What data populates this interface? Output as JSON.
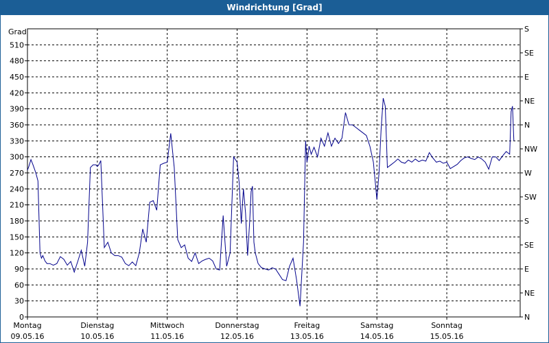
{
  "window": {
    "title": "Windrichtung [Grad]"
  },
  "chart_data": {
    "type": "line",
    "title": "Windrichtung [Grad]",
    "ylabel": "Grad",
    "ylim": [
      0,
      540
    ],
    "ylim_note": "",
    "yticks": [
      0,
      30,
      60,
      90,
      120,
      150,
      180,
      210,
      240,
      270,
      300,
      330,
      360,
      390,
      420,
      450,
      480,
      510
    ],
    "right_ticks": [
      "N",
      "NE",
      "E",
      "SE",
      "S",
      "SW",
      "W",
      "NW",
      "N",
      "NE",
      "E",
      "SE",
      "S"
    ],
    "xlim": [
      0,
      7.05
    ],
    "days": [
      {
        "name": "Montag",
        "date": "09.05.16"
      },
      {
        "name": "Dienstag",
        "date": "10.05.16"
      },
      {
        "name": "Mittwoch",
        "date": "11.05.16"
      },
      {
        "name": "Donnerstag",
        "date": "12.05.16"
      },
      {
        "name": "Freitag",
        "date": "13.05.16"
      },
      {
        "name": "Samstag",
        "date": "14.05.16"
      },
      {
        "name": "Sonntag",
        "date": "15.05.16"
      }
    ],
    "line_color": "#00008b",
    "grid": true,
    "x": [
      0,
      0.02,
      0.05,
      0.08,
      0.12,
      0.15,
      0.18,
      0.2,
      0.22,
      0.25,
      0.28,
      0.32,
      0.37,
      0.42,
      0.47,
      0.52,
      0.57,
      0.62,
      0.67,
      0.72,
      0.77,
      0.82,
      0.86,
      0.9,
      0.94,
      0.98,
      1.0,
      1.02,
      1.05,
      1.1,
      1.15,
      1.2,
      1.25,
      1.3,
      1.35,
      1.4,
      1.45,
      1.5,
      1.55,
      1.6,
      1.65,
      1.7,
      1.75,
      1.8,
      1.85,
      1.9,
      1.95,
      2.0,
      2.05,
      2.1,
      2.15,
      2.2,
      2.25,
      2.3,
      2.35,
      2.4,
      2.45,
      2.5,
      2.55,
      2.6,
      2.65,
      2.7,
      2.75,
      2.8,
      2.85,
      2.9,
      2.95,
      3.0,
      3.03,
      3.06,
      3.09,
      3.12,
      3.15,
      3.18,
      3.2,
      3.22,
      3.24,
      3.26,
      3.3,
      3.35,
      3.4,
      3.45,
      3.5,
      3.55,
      3.6,
      3.65,
      3.7,
      3.75,
      3.8,
      3.85,
      3.9,
      3.95,
      3.98,
      4.0,
      4.03,
      4.06,
      4.1,
      4.15,
      4.2,
      4.25,
      4.3,
      4.35,
      4.4,
      4.45,
      4.5,
      4.55,
      4.6,
      4.65,
      4.7,
      4.75,
      4.8,
      4.85,
      4.9,
      4.95,
      5.0,
      5.03,
      5.06,
      5.09,
      5.12,
      5.15,
      5.2,
      5.25,
      5.3,
      5.35,
      5.4,
      5.45,
      5.5,
      5.55,
      5.6,
      5.65,
      5.7,
      5.75,
      5.8,
      5.85,
      5.9,
      5.95,
      6.0,
      6.05,
      6.1,
      6.15,
      6.2,
      6.25,
      6.3,
      6.35,
      6.4,
      6.45,
      6.5,
      6.55,
      6.6,
      6.65,
      6.7,
      6.75,
      6.8,
      6.85,
      6.9,
      6.92,
      6.94,
      6.96,
      6.98,
      7.0
    ],
    "y": [
      275,
      282,
      295,
      285,
      270,
      255,
      120,
      110,
      115,
      105,
      100,
      100,
      97,
      100,
      113,
      108,
      97,
      104,
      84,
      104,
      125,
      95,
      140,
      280,
      285,
      285,
      282,
      285,
      293,
      130,
      140,
      120,
      115,
      115,
      112,
      100,
      96,
      103,
      96,
      120,
      165,
      140,
      215,
      218,
      200,
      285,
      288,
      290,
      344,
      280,
      145,
      130,
      135,
      110,
      104,
      120,
      100,
      105,
      108,
      110,
      105,
      90,
      88,
      190,
      95,
      120,
      300,
      290,
      250,
      175,
      240,
      195,
      115,
      180,
      235,
      245,
      140,
      120,
      100,
      92,
      90,
      88,
      92,
      90,
      80,
      70,
      68,
      95,
      110,
      70,
      20,
      140,
      330,
      290,
      320,
      305,
      318,
      300,
      335,
      320,
      345,
      320,
      335,
      325,
      335,
      383,
      360,
      360,
      355,
      350,
      345,
      340,
      320,
      290,
      220,
      270,
      350,
      410,
      395,
      280,
      285,
      290,
      296,
      290,
      288,
      294,
      290,
      296,
      291,
      294,
      292,
      308,
      298,
      290,
      292,
      288,
      290,
      278,
      282,
      286,
      293,
      298,
      300,
      297,
      295,
      300,
      296,
      290,
      277,
      300,
      300,
      293,
      302,
      310,
      305,
      385,
      395,
      330
    ]
  }
}
